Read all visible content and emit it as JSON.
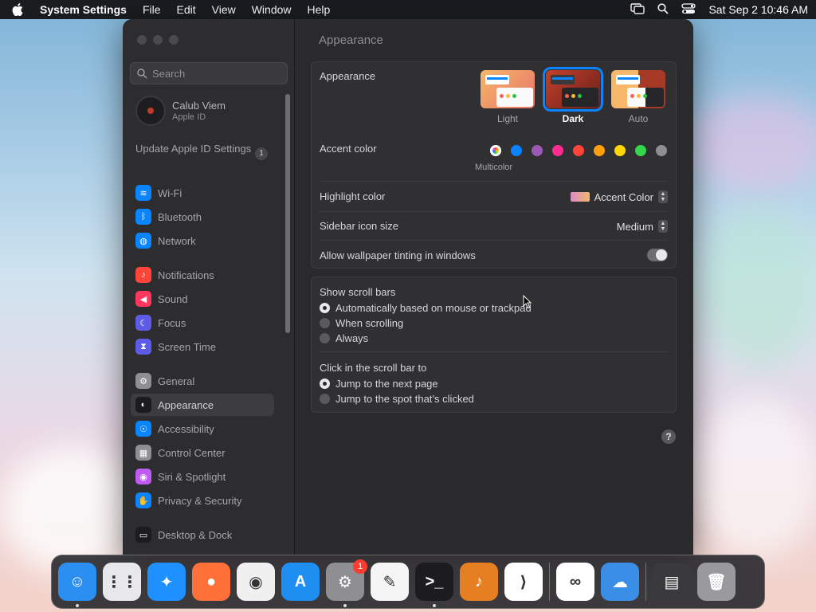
{
  "menubar": {
    "app_name": "System Settings",
    "menus": [
      "File",
      "Edit",
      "View",
      "Window",
      "Help"
    ],
    "clock": "Sat Sep 2  10:46 AM"
  },
  "sidebar": {
    "search_placeholder": "Search",
    "profile": {
      "name": "Calub Viem",
      "sub": "Apple ID"
    },
    "update": {
      "label": "Update Apple ID Settings",
      "badge": "1"
    },
    "items": [
      {
        "label": "Wi-Fi",
        "color": "#0a84ff",
        "icon": "wifi-icon"
      },
      {
        "label": "Bluetooth",
        "color": "#0a84ff",
        "icon": "bluetooth-icon"
      },
      {
        "label": "Network",
        "color": "#0a84ff",
        "icon": "globe-icon"
      },
      {
        "label": "Notifications",
        "color": "#ff453a",
        "icon": "bell-icon"
      },
      {
        "label": "Sound",
        "color": "#ff375f",
        "icon": "speaker-icon"
      },
      {
        "label": "Focus",
        "color": "#5e5ce6",
        "icon": "moon-icon"
      },
      {
        "label": "Screen Time",
        "color": "#5e5ce6",
        "icon": "hourglass-icon"
      },
      {
        "label": "General",
        "color": "#8e8e93",
        "icon": "gear-icon"
      },
      {
        "label": "Appearance",
        "color": "#1c1c1e",
        "icon": "appearance-icon"
      },
      {
        "label": "Accessibility",
        "color": "#0a84ff",
        "icon": "accessibility-icon"
      },
      {
        "label": "Control Center",
        "color": "#8e8e93",
        "icon": "control-center-icon"
      },
      {
        "label": "Siri & Spotlight",
        "color": "#bf5af2",
        "icon": "siri-icon"
      },
      {
        "label": "Privacy & Security",
        "color": "#0a84ff",
        "icon": "hand-icon"
      },
      {
        "label": "Desktop & Dock",
        "color": "#1c1c1e",
        "icon": "dock-icon"
      }
    ]
  },
  "content": {
    "title": "Appearance",
    "appearance": {
      "label": "Appearance",
      "options": [
        "Light",
        "Dark",
        "Auto"
      ],
      "selected": "Dark"
    },
    "accent": {
      "label": "Accent color",
      "selected_label": "Multicolor",
      "colors": [
        "#ffffff",
        "#0a84ff",
        "#9b59b6",
        "#ff2d92",
        "#ff453a",
        "#ff9f0a",
        "#ffd60a",
        "#32d74b",
        "#8e8e93"
      ]
    },
    "highlight": {
      "label": "Highlight color",
      "value": "Accent Color"
    },
    "icon_size": {
      "label": "Sidebar icon size",
      "value": "Medium"
    },
    "tinting": {
      "label": "Allow wallpaper tinting in windows"
    },
    "scroll_bars": {
      "label": "Show scroll bars",
      "options": [
        "Automatically based on mouse or trackpad",
        "When scrolling",
        "Always"
      ],
      "selected": 0
    },
    "click_scroll": {
      "label": "Click in the scroll bar to",
      "options": [
        "Jump to the next page",
        "Jump to the spot that’s clicked"
      ],
      "selected": 0
    },
    "help": "?"
  },
  "dock": {
    "apps": [
      {
        "name": "finder-icon",
        "color": "#2a8ff0",
        "glyph": "☺",
        "running": true
      },
      {
        "name": "launchpad-icon",
        "color": "#e8e8ea",
        "glyph": "⋮⋮",
        "running": false
      },
      {
        "name": "safari-icon",
        "color": "#1e90ff",
        "glyph": "✦",
        "running": false
      },
      {
        "name": "firefox-icon",
        "color": "#ff7139",
        "glyph": "●",
        "running": false
      },
      {
        "name": "chrome-icon",
        "color": "#f0f0f0",
        "glyph": "◉",
        "running": false
      },
      {
        "name": "app-store-icon",
        "color": "#1f8ef1",
        "glyph": "A",
        "running": false
      },
      {
        "name": "system-settings-icon",
        "color": "#8e8e93",
        "glyph": "⚙",
        "running": true,
        "badge": "1"
      },
      {
        "name": "textedit-icon",
        "color": "#f5f5f5",
        "glyph": "✎",
        "running": false
      },
      {
        "name": "terminal-icon",
        "color": "#1c1c1e",
        "glyph": ">_",
        "running": true
      },
      {
        "name": "garageband-icon",
        "color": "#e67e22",
        "glyph": "♪",
        "running": false
      },
      {
        "name": "vscode-icon",
        "color": "#ffffff",
        "glyph": "⟩",
        "running": false
      },
      {
        "name": "visual-studio-icon",
        "color": "#ffffff",
        "glyph": "∞",
        "running": false
      },
      {
        "name": "weather-icon",
        "color": "#3a8ee6",
        "glyph": "☁",
        "running": false
      },
      {
        "name": "downloads-stack-icon",
        "color": "#3a3a3c",
        "glyph": "▤",
        "running": false
      },
      {
        "name": "trash-icon",
        "color": "#9a9a9e",
        "glyph": "🗑",
        "running": false
      }
    ]
  }
}
